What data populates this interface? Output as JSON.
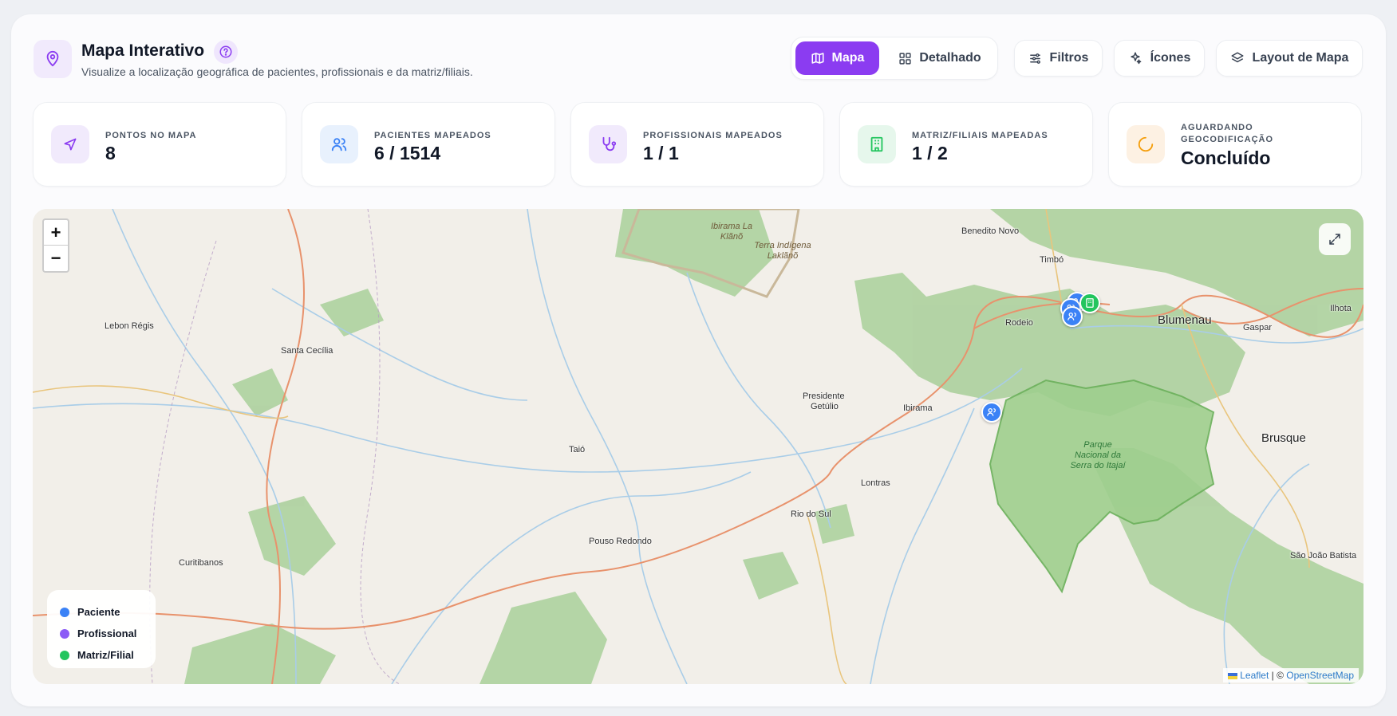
{
  "header": {
    "title": "Mapa Interativo",
    "subtitle": "Visualize a localização geográfica de pacientes, profissionais e da matriz/filiais.",
    "icon": "map-pin-icon",
    "help_icon": "help-circle-icon"
  },
  "toolbar": {
    "view_toggle": [
      {
        "label": "Mapa",
        "icon": "map-icon",
        "active": true
      },
      {
        "label": "Detalhado",
        "icon": "grid-icon",
        "active": false
      }
    ],
    "filters_label": "Filtros",
    "icons_label": "Ícones",
    "layout_label": "Layout de Mapa"
  },
  "stats": [
    {
      "label": "Pontos no mapa",
      "value": "8",
      "icon": "navigation-icon"
    },
    {
      "label": "Pacientes mapeados",
      "value": "6 / 1514",
      "icon": "users-icon"
    },
    {
      "label": "Profissionais mapeados",
      "value": "1 / 1",
      "icon": "stethoscope-icon"
    },
    {
      "label": "Matriz/Filiais mapeadas",
      "value": "1 / 2",
      "icon": "building-icon"
    },
    {
      "label": "Aguardando geocodificação",
      "value": "Concluído",
      "icon": "loader-icon"
    }
  ],
  "map": {
    "zoom_in": "+",
    "zoom_out": "−",
    "places": {
      "benedito_novo": "Benedito Novo",
      "timbo": "Timbó",
      "rodeio": "Rodeio",
      "blumenau": "Blumenau",
      "gaspar": "Gaspar",
      "ilhota": "Ilhota",
      "lebon_regis": "Lebon Régis",
      "santa_cecilia": "Santa Cecília",
      "presidente_getulio_1": "Presidente",
      "presidente_getulio_2": "Getúlio",
      "ibirama": "Ibirama",
      "taio": "Taió",
      "lontras": "Lontras",
      "rio_do_sul": "Rio do Sul",
      "pouso_redondo": "Pouso Redondo",
      "curitibanos": "Curitibanos",
      "brusque": "Brusque",
      "sao_joao_batista": "São João Batista",
      "ibirama_laklano": "Ibirama La Klãnõ",
      "terra_indigena": "Terra Indígena Laklãnõ",
      "parque": "Parque Nacional da Serra do Itajaí"
    },
    "attribution": {
      "leaflet": "Leaflet",
      "separator": "|",
      "copyright": "©",
      "osm": "OpenStreetMap"
    }
  },
  "legend": [
    {
      "label": "Paciente",
      "color": "#3b82f6"
    },
    {
      "label": "Profissional",
      "color": "#8b5cf6"
    },
    {
      "label": "Matriz/Filial",
      "color": "#22c55e"
    }
  ],
  "colors": {
    "accent": "#8b3cf1",
    "patient": "#3b82f6",
    "professional": "#8b5cf6",
    "branch": "#22c55e"
  }
}
